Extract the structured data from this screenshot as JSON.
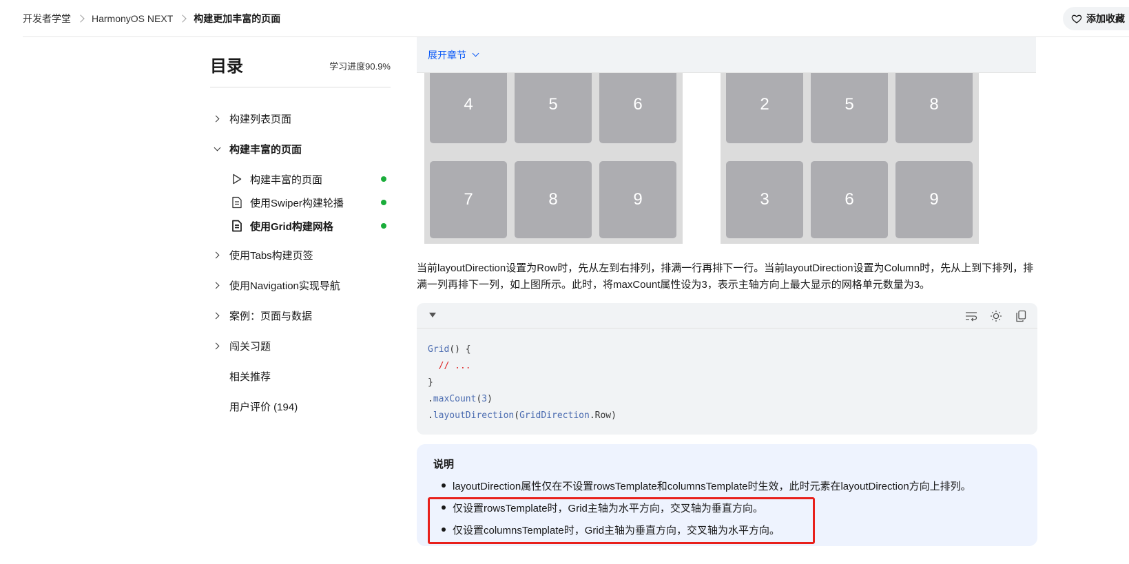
{
  "breadcrumb": [
    "开发者学堂",
    "HarmonyOS NEXT",
    "构建更加丰富的页面"
  ],
  "favorite_label": "添加收藏",
  "toc": {
    "title": "目录",
    "progress": "学习进度90.9%",
    "items": [
      {
        "label": "构建列表页面",
        "expanded": false
      },
      {
        "label": "构建丰富的页面",
        "expanded": true
      },
      {
        "label": "使用Tabs构建页签",
        "expanded": false
      },
      {
        "label": "使用Navigation实现导航",
        "expanded": false
      },
      {
        "label": "案例：页面与数据",
        "expanded": false
      },
      {
        "label": "闯关习题",
        "expanded": false
      }
    ],
    "subitems": [
      {
        "label": "构建丰富的页面",
        "icon": "play-icon",
        "done": true
      },
      {
        "label": "使用Swiper构建轮播",
        "icon": "document-icon",
        "done": true
      },
      {
        "label": "使用Grid构建网格",
        "icon": "document-icon",
        "done": true,
        "active": true
      }
    ],
    "extras": [
      "相关推荐",
      "用户评价 (194)"
    ]
  },
  "expand_label": "展开章节",
  "grid_left": [
    "4",
    "5",
    "6",
    "7",
    "8",
    "9"
  ],
  "grid_right": [
    "2",
    "5",
    "8",
    "3",
    "6",
    "9"
  ],
  "paragraph": "当前layoutDirection设置为Row时，先从左到右排列，排满一行再排下一行。当前layoutDirection设置为Column时，先从上到下排列，排满一列再排下一列，如上图所示。此时，将maxCount属性设为3，表示主轴方向上最大显示的网格单元数量为3。",
  "code": {
    "line1_fn": "Grid",
    "line1_rest": "() {",
    "line2": "  // ...",
    "line3": "}",
    "line4_dot": ".",
    "line4_fn": "maxCount",
    "line4_open": "(",
    "line4_num": "3",
    "line4_close": ")",
    "line5_dot": ".",
    "line5_fn": "layoutDirection",
    "line5_open": "(",
    "line5_cls": "GridDirection",
    "line5_rest": ".Row)"
  },
  "note": {
    "title": "说明",
    "items": [
      "layoutDirection属性仅在不设置rowsTemplate和columnsTemplate时生效，此时元素在layoutDirection方向上排列。",
      "仅设置rowsTemplate时，Grid主轴为水平方向，交叉轴为垂直方向。",
      "仅设置columnsTemplate时，Grid主轴为垂直方向，交叉轴为水平方向。"
    ]
  },
  "colors": {
    "accent": "#0a59f7",
    "done_dot": "#1aad3a",
    "highlight": "#e8201b"
  }
}
